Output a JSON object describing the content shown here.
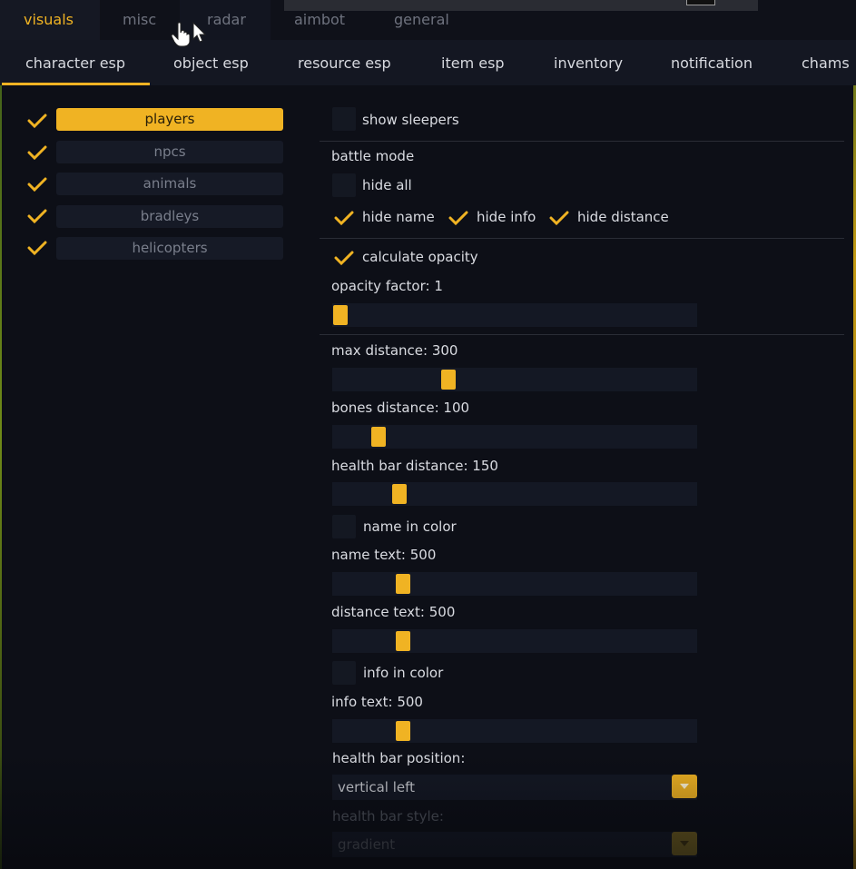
{
  "main_tabs": [
    {
      "label": "visuals",
      "active": true
    },
    {
      "label": "misc",
      "active": false
    },
    {
      "label": "radar",
      "active": false
    },
    {
      "label": "aimbot",
      "active": false
    },
    {
      "label": "general",
      "active": false
    }
  ],
  "sub_tabs": [
    {
      "label": "character esp",
      "active": true
    },
    {
      "label": "object esp"
    },
    {
      "label": "resource esp"
    },
    {
      "label": "item esp"
    },
    {
      "label": "inventory"
    },
    {
      "label": "notification"
    },
    {
      "label": "chams"
    }
  ],
  "targets": [
    {
      "label": "players",
      "checked": true,
      "selected": true
    },
    {
      "label": "npcs",
      "checked": true
    },
    {
      "label": "animals",
      "checked": true
    },
    {
      "label": "bradleys",
      "checked": true
    },
    {
      "label": "helicopters",
      "checked": true
    }
  ],
  "settings": {
    "show_sleepers": {
      "label": "show sleepers",
      "checked": false
    },
    "battle_mode": {
      "label": "battle mode"
    },
    "hide_all": {
      "label": "hide all",
      "checked": false
    },
    "hide_name": {
      "label": "hide name",
      "checked": true
    },
    "hide_info": {
      "label": "hide info",
      "checked": true
    },
    "hide_distance": {
      "label": "hide distance",
      "checked": true
    },
    "calculate_opacity": {
      "label": "calculate opacity",
      "checked": true
    },
    "opacity_factor": {
      "label": "opacity factor: 1",
      "value": 1,
      "fraction": 0.0
    },
    "max_distance": {
      "label": "max distance: 300",
      "value": 300,
      "fraction": 0.31
    },
    "bones_distance": {
      "label": "bones distance: 100",
      "value": 100,
      "fraction": 0.11
    },
    "health_bar_distance": {
      "label": "health bar distance: 150",
      "value": 150,
      "fraction": 0.17
    },
    "name_in_color": {
      "label": "name in color",
      "checked": false
    },
    "name_text": {
      "label": "name text: 500",
      "value": 500,
      "fraction": 0.18
    },
    "distance_text": {
      "label": "distance text: 500",
      "value": 500,
      "fraction": 0.18
    },
    "info_in_color": {
      "label": "info in color",
      "checked": false
    },
    "info_text": {
      "label": "info text: 500",
      "value": 500,
      "fraction": 0.18
    },
    "health_bar_position": {
      "label": "health bar position:",
      "value": "vertical left"
    },
    "health_bar_style": {
      "label": "health bar style:",
      "value": "gradient"
    }
  },
  "colors": {
    "accent": "#f0b323",
    "background": "#0d0f17",
    "panel": "#141824"
  },
  "icons": {
    "check": "check-icon",
    "dropdown": "chevron-down-icon",
    "cursor": "hand-pointer-icon"
  }
}
